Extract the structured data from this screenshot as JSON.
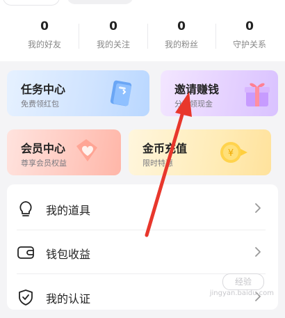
{
  "stats": [
    {
      "value": "0",
      "label": "我的好友"
    },
    {
      "value": "0",
      "label": "我的关注"
    },
    {
      "value": "0",
      "label": "我的粉丝"
    },
    {
      "value": "0",
      "label": "守护关系"
    }
  ],
  "tiles": {
    "task": {
      "title": "任务中心",
      "subtitle": "免费领红包"
    },
    "invite": {
      "title": "邀请赚钱",
      "subtitle": "分享领现金"
    },
    "vip": {
      "title": "会员中心",
      "subtitle": "尊享会员权益"
    },
    "coins": {
      "title": "金币充值",
      "subtitle": "限时特惠"
    }
  },
  "menu": [
    {
      "label": "我的道具",
      "icon": "lightbulb-icon"
    },
    {
      "label": "钱包收益",
      "icon": "wallet-icon"
    },
    {
      "label": "我的认证",
      "icon": "shield-check-icon"
    }
  ],
  "watermark": {
    "badge": "经验",
    "text": "jingyan.baidu.com"
  },
  "colors": {
    "annotation_arrow": "#e8372c"
  }
}
